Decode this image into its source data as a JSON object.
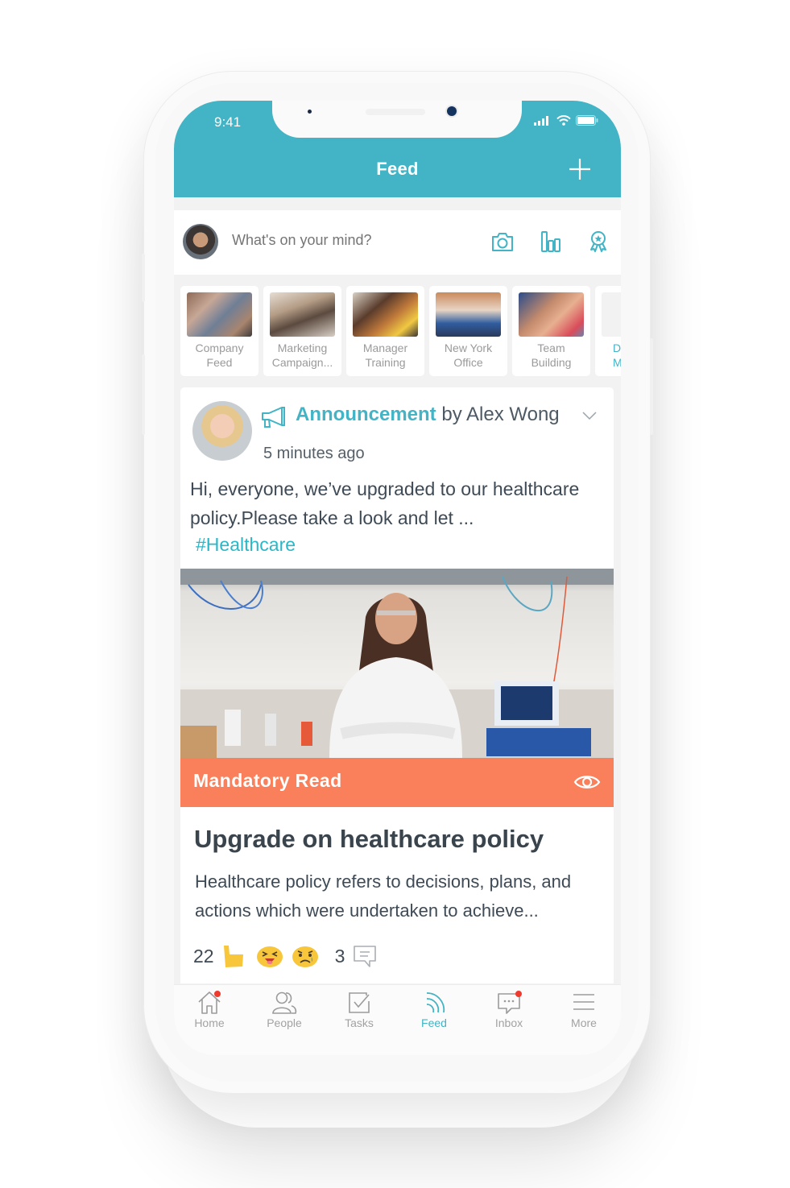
{
  "status_bar": {
    "time": "9:41"
  },
  "header": {
    "title": "Feed",
    "add_icon": "plus-icon"
  },
  "composer": {
    "placeholder": "What's on your mind?",
    "actions": [
      {
        "name": "camera-icon"
      },
      {
        "name": "poll-icon"
      },
      {
        "name": "award-icon"
      }
    ]
  },
  "groups": [
    {
      "line1": "Company",
      "line2": "Feed"
    },
    {
      "line1": "Marketing",
      "line2": "Campaign..."
    },
    {
      "line1": "Manager",
      "line2": "Training"
    },
    {
      "line1": "New York",
      "line2": "Office"
    },
    {
      "line1": "Team",
      "line2": "Building"
    },
    {
      "line1": "Di",
      "line2": "M"
    }
  ],
  "post": {
    "type_label": "Announcement",
    "by_label": " by Alex Wong",
    "time": "5 minutes ago",
    "body": "Hi, everyone, we’ve upgraded to our healthcare policy.Please take a look and let ...",
    "hashtag": "#Healthcare",
    "banner_label": "Mandatory Read",
    "article_title": "Upgrade on healthcare policy",
    "article_desc": "Healthcare policy refers to decisions, plans, and actions which were undertaken to achieve...",
    "reaction_count": "22",
    "comment_count": "3"
  },
  "tabbar": {
    "items": [
      {
        "label": "Home",
        "badge": true
      },
      {
        "label": "People",
        "badge": false
      },
      {
        "label": "Tasks",
        "badge": false
      },
      {
        "label": "Feed",
        "badge": false,
        "active": true
      },
      {
        "label": "Inbox",
        "badge": true
      },
      {
        "label": "More",
        "badge": false
      }
    ]
  },
  "colors": {
    "accent": "#42b4c5",
    "mandatory": "#f9805a",
    "badge": "#f03a2e",
    "text": "#3e4a55"
  }
}
